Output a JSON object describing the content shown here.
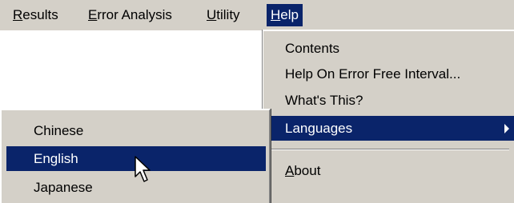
{
  "menubar": {
    "items": [
      {
        "mnemonic": "R",
        "rest": "esults"
      },
      {
        "mnemonic": "E",
        "rest": "rror Analysis"
      },
      {
        "mnemonic": "U",
        "rest": "tility"
      },
      {
        "mnemonic": "H",
        "rest": "elp"
      }
    ],
    "active_item": "Help"
  },
  "help_menu": {
    "contents": "Contents",
    "help_on_error_free_interval": "Help On Error Free Interval...",
    "whats_this": "What's This?",
    "languages": "Languages",
    "about_mnemonic": "A",
    "about_rest": "bout"
  },
  "languages_submenu": {
    "items": [
      "Chinese",
      "English",
      "Japanese"
    ],
    "selected": "English"
  },
  "icons": {
    "submenu_arrow": "triangle-right-icon",
    "cursor": "mouse-pointer-icon"
  },
  "colors": {
    "menu_background": "#d4d0c8",
    "highlight": "#0a246a",
    "highlight_text": "#ffffff"
  }
}
